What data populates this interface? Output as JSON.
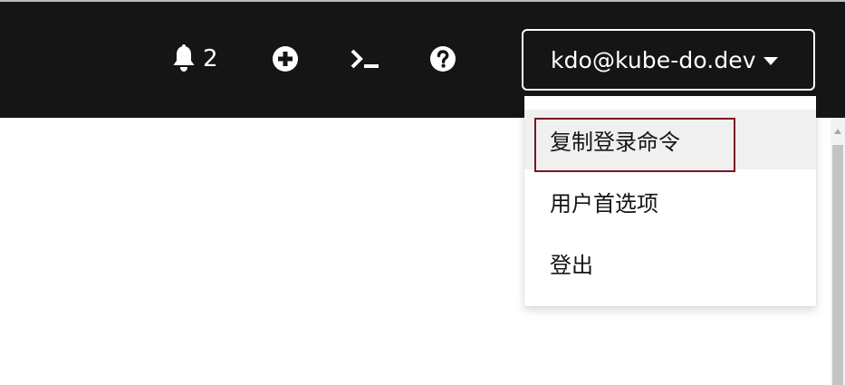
{
  "masthead": {
    "notifications": {
      "icon": "bell-icon",
      "count": "2"
    },
    "add_icon": "plus-circle-icon",
    "terminal_icon": "terminal-icon",
    "help_icon": "question-circle-icon",
    "user_menu": {
      "username": "kdo@kube-do.dev",
      "caret_icon": "caret-down-icon",
      "items": [
        {
          "label": "复制登录命令"
        },
        {
          "label": "用户首选项"
        },
        {
          "label": "登出"
        }
      ]
    }
  },
  "colors": {
    "masthead_bg": "#151515",
    "highlight_border": "#7a1523",
    "menu_hover_bg": "#f0f0f0"
  }
}
